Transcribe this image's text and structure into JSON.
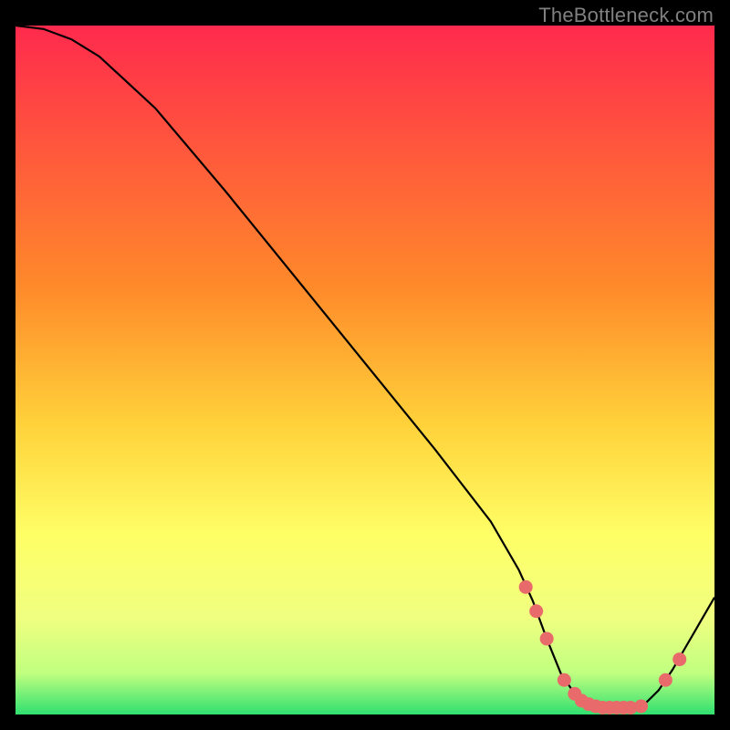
{
  "watermark": "TheBottleneck.com",
  "colors": {
    "bg": "#000000",
    "frame": "#000000",
    "curve": "#000000",
    "marker_fill": "#e86a6a",
    "marker_stroke": "#e86a6a",
    "grad_top": "#ff2a4d",
    "grad_mid1": "#ff8a2a",
    "grad_mid2": "#ffd23a",
    "grad_mid3": "#ffff66",
    "grad_mid4": "#f0ff80",
    "grad_bot_pre": "#c0ff80",
    "grad_bot": "#30e070"
  },
  "chart_data": {
    "type": "line",
    "title": "",
    "xlabel": "",
    "ylabel": "",
    "xlim": [
      0,
      100
    ],
    "ylim": [
      0,
      100
    ],
    "series": [
      {
        "name": "bottleneck-curve",
        "x": [
          0,
          4,
          8,
          12,
          20,
          30,
          40,
          50,
          60,
          68,
          72,
          74,
          76,
          78,
          80,
          82,
          84,
          86,
          88,
          90,
          92,
          94,
          96,
          98,
          100
        ],
        "values": [
          100,
          99.5,
          98.0,
          95.5,
          88.0,
          76.0,
          63.5,
          51.0,
          38.5,
          28.0,
          21.0,
          16.5,
          11.0,
          6.0,
          3.0,
          1.5,
          1.0,
          1.0,
          1.0,
          1.5,
          3.5,
          6.5,
          10.0,
          13.5,
          17.0
        ]
      }
    ],
    "markers": {
      "name": "highlighted-points",
      "x": [
        73.0,
        74.5,
        76.0,
        78.5,
        80.0,
        81.0,
        82.0,
        83.0,
        84.0,
        85.0,
        86.0,
        87.0,
        88.0,
        89.5,
        93.0,
        95.0
      ],
      "values": [
        18.5,
        15.0,
        11.0,
        5.0,
        3.0,
        2.0,
        1.5,
        1.2,
        1.0,
        1.0,
        1.0,
        1.0,
        1.0,
        1.2,
        5.0,
        8.0
      ]
    }
  }
}
